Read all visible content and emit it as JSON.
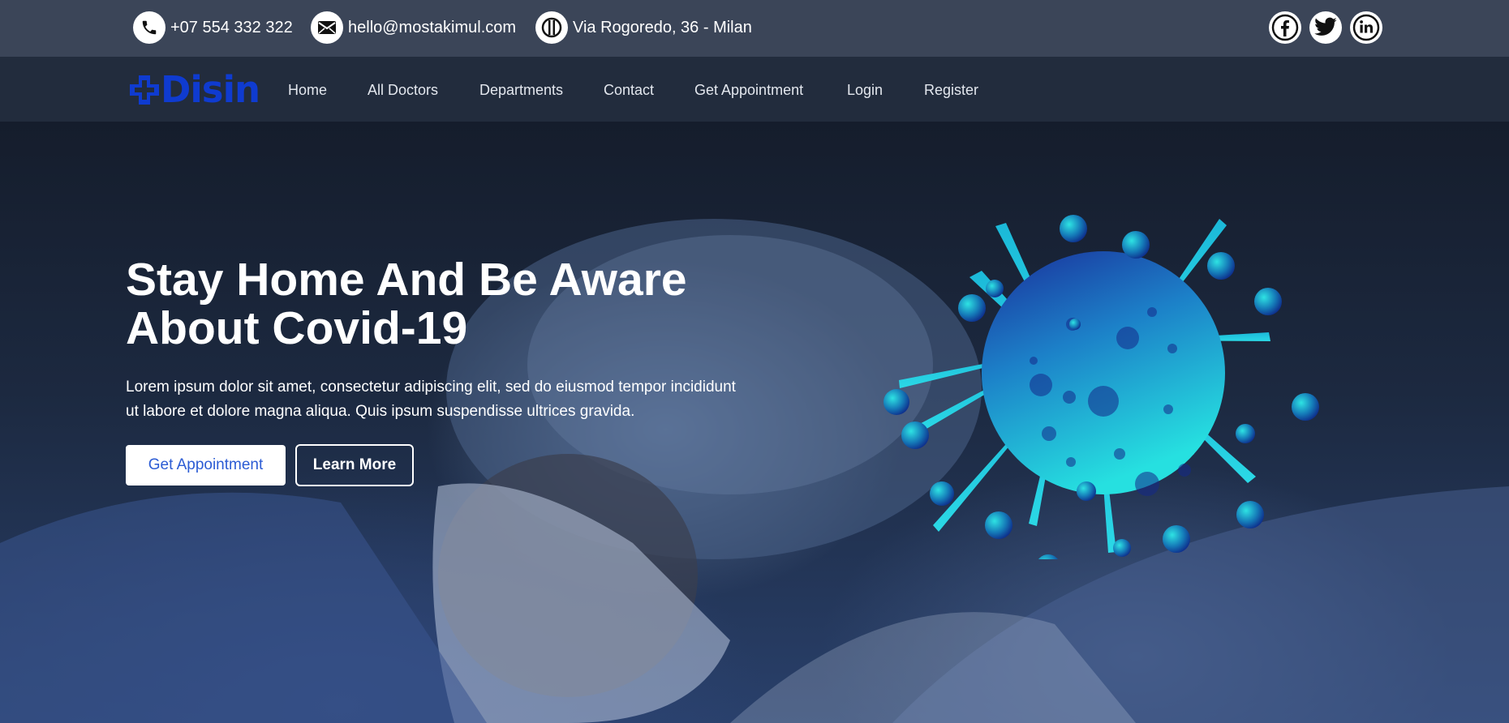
{
  "topbar": {
    "phone": {
      "icon": "phone-icon",
      "text": "+07 554 332 322"
    },
    "email": {
      "icon": "envelope-icon",
      "text": "hello@mostakimul.com"
    },
    "address": {
      "icon": "location-icon",
      "text": "Via Rogoredo, 36 - Milan"
    },
    "social": [
      {
        "icon": "facebook-icon",
        "glyph": "f"
      },
      {
        "icon": "twitter-icon",
        "glyph": "t"
      },
      {
        "icon": "linkedin-icon",
        "glyph": "in"
      }
    ]
  },
  "brand": {
    "name": "Disin",
    "color": "#0f3bd0"
  },
  "nav": {
    "items": [
      "Home",
      "All Doctors",
      "Departments",
      "Contact",
      "Get Appointment",
      "Login",
      "Register"
    ]
  },
  "hero": {
    "title": "Stay Home And Be Aware About Covid-19",
    "text": "Lorem ipsum dolor sit amet, consectetur adipiscing elit, sed do eiusmod tempor incididunt ut labore et dolore magna aliqua. Quis ipsum suspendisse ultrices gravida.",
    "primary_button": "Get Appointment",
    "secondary_button": "Learn More"
  },
  "colors": {
    "accent": "#2c5cd4",
    "topbar": "#3b4558",
    "navbar": "#222c3d"
  }
}
